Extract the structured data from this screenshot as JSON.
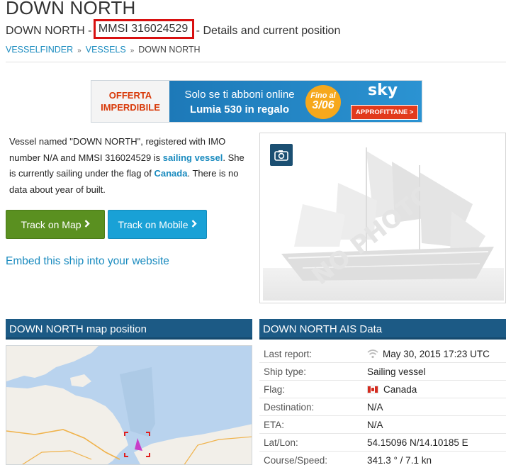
{
  "header": {
    "title": "DOWN NORTH",
    "subtitle_prefix": "DOWN NORTH - ",
    "subtitle_mmsi": "MMSI 316024529",
    "subtitle_suffix": " - Details and current position"
  },
  "breadcrumb": [
    {
      "label": "VESSELFINDER"
    },
    {
      "label": "VESSELS"
    },
    {
      "label": "DOWN NORTH"
    }
  ],
  "banner": {
    "left_line1": "OFFERTA",
    "left_line2": "IMPERDIBILE",
    "text_line1": "Solo se ti abboni online",
    "text_line2": "Lumia 530 in regalo",
    "badge_small": "Fino al",
    "badge_big": "3/06",
    "brand": "sky",
    "cta": "APPROFITTANE >"
  },
  "description": {
    "part1": "Vessel named \"DOWN NORTH\", registered with IMO number N/A and MMSI 316024529 is ",
    "type_link": "sailing vessel",
    "part2": ". She is currently sailing under the flag of ",
    "flag_link": "Canada",
    "part3": ". There is no data about year of built."
  },
  "buttons": {
    "track_map": "Track on Map",
    "track_mobile": "Track on Mobile",
    "chevron": "›"
  },
  "embed_link": "Embed this ship into your website",
  "photo": {
    "watermark": "NO PHOTO",
    "camera_icon": "camera-icon"
  },
  "map_panel": {
    "title": "DOWN NORTH map position"
  },
  "ais_panel": {
    "title": "DOWN NORTH AIS Data",
    "rows": [
      {
        "label": "Last report:",
        "value": "May 30, 2015 17:23 UTC",
        "icon": "signal-icon"
      },
      {
        "label": "Ship type:",
        "value": "Sailing vessel"
      },
      {
        "label": "Flag:",
        "value": "Canada",
        "icon": "canada-flag-icon"
      },
      {
        "label": "Destination:",
        "value": "N/A"
      },
      {
        "label": "ETA:",
        "value": "N/A"
      },
      {
        "label": "Lat/Lon:",
        "value": "54.15096 N/14.10185 E"
      },
      {
        "label": "Course/Speed:",
        "value": "341.3 ° / 7.1 kn"
      }
    ]
  },
  "colors": {
    "link": "#1a8bbf",
    "panel_header": "#1c5a85",
    "track_map_button": "#5a9020",
    "track_mobile_button": "#19a1d6",
    "highlight_border": "#d81010",
    "ship_marker": "#c83ec8"
  }
}
